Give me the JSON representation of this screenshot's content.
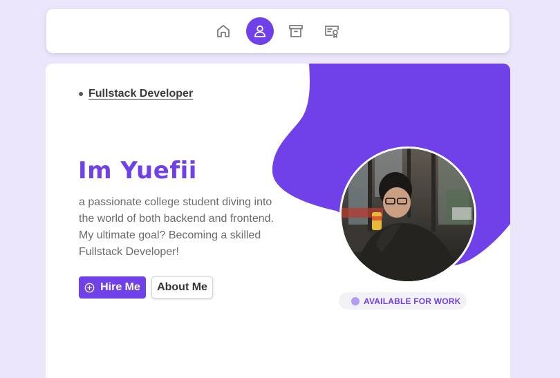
{
  "colors": {
    "background": "#ebe6fb",
    "accent": "#7040e8",
    "card": "#ffffff"
  },
  "nav": {
    "items": [
      {
        "icon": "home-icon",
        "active": false
      },
      {
        "icon": "user-icon",
        "active": true
      },
      {
        "icon": "archive-icon",
        "active": false
      },
      {
        "icon": "certificate-icon",
        "active": false
      }
    ]
  },
  "hero": {
    "role": "Fullstack Developer",
    "headline": "Im Yuefii",
    "intro": "a passionate college student diving into the world of both backend and frontend. My ultimate goal? Becoming a skilled Fullstack Developer!",
    "hire_label": "Hire Me",
    "about_label": "About Me",
    "status": "AVAILABLE FOR WORK"
  }
}
